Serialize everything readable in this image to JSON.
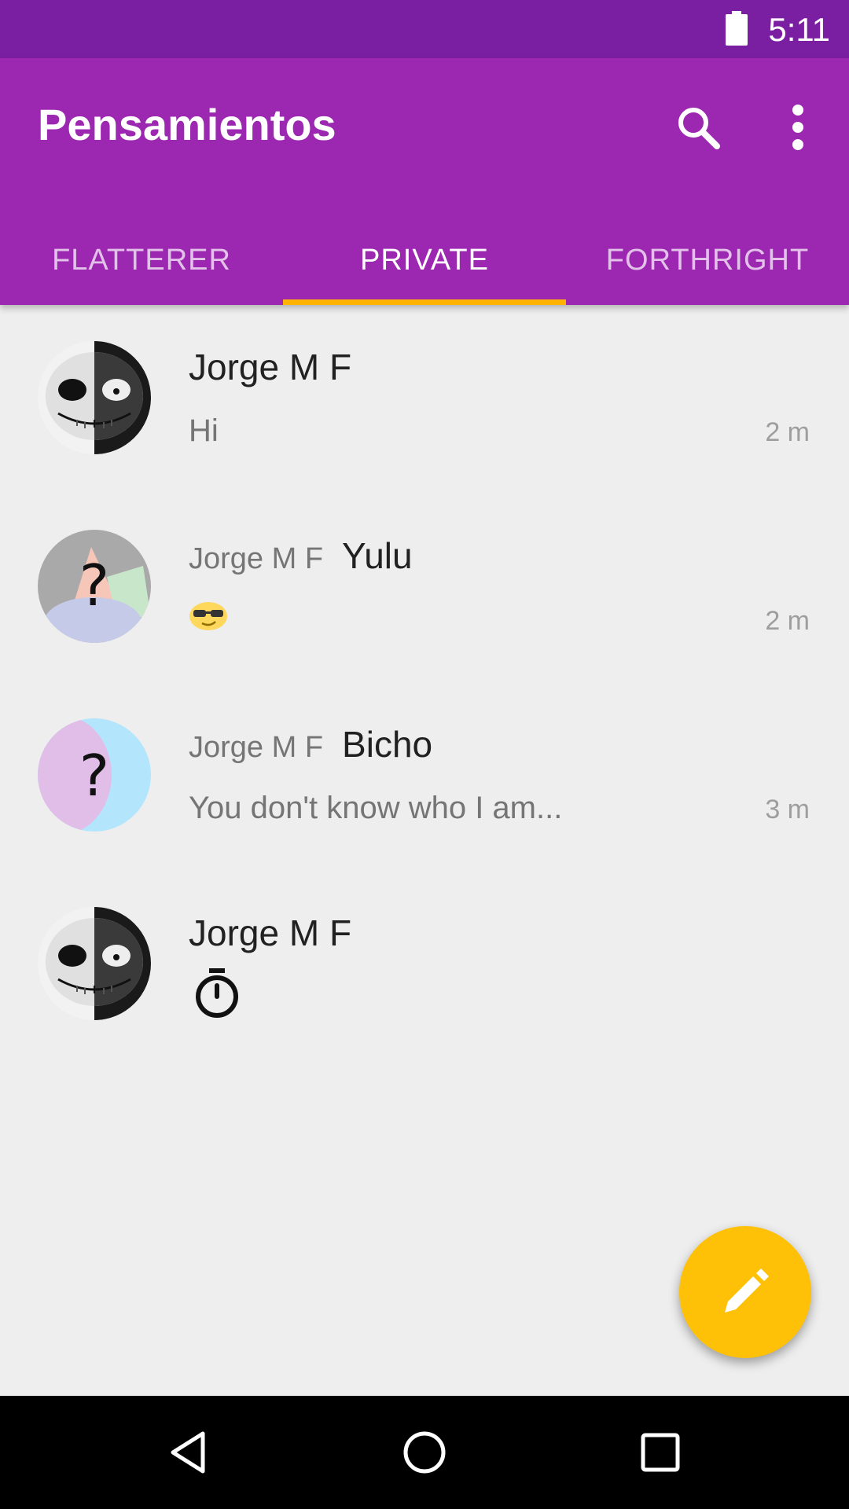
{
  "status_bar": {
    "time": "5:11",
    "battery_icon": "battery-full-icon"
  },
  "app_bar": {
    "title": "Pensamientos",
    "search_icon": "search-icon",
    "more_icon": "more-vert-icon"
  },
  "tabs": [
    {
      "label": "FLATTERER",
      "active": false
    },
    {
      "label": "PRIVATE",
      "active": true
    },
    {
      "label": "FORTHRIGHT",
      "active": false
    }
  ],
  "colors": {
    "status_bar": "#7b1fa2",
    "app_bar": "#9c27b0",
    "tab_indicator": "#ffb300",
    "fab": "#ffc107",
    "background": "#eeeeee"
  },
  "messages": [
    {
      "sender": "Jorge M F",
      "recipient": "",
      "text": "Hi",
      "time": "2 m",
      "avatar": "jack-skellington-avatar"
    },
    {
      "sender": "Jorge M F",
      "recipient": "Yulu",
      "text": "",
      "content_icon": "sunglasses-emoji-icon",
      "time": "2 m",
      "avatar": "anonymous-avatar"
    },
    {
      "sender": "Jorge M F",
      "recipient": "Bicho",
      "text": "You don't know who I am...",
      "time": "3 m",
      "avatar": "anonymous-avatar"
    },
    {
      "sender": "Jorge M F",
      "recipient": "",
      "text": "",
      "content_icon": "timer-icon",
      "time": "",
      "avatar": "jack-skellington-avatar"
    }
  ],
  "fab": {
    "icon": "edit-pencil-icon"
  },
  "nav_bar": {
    "back_icon": "back-icon",
    "home_icon": "home-icon",
    "recents_icon": "recents-icon"
  }
}
